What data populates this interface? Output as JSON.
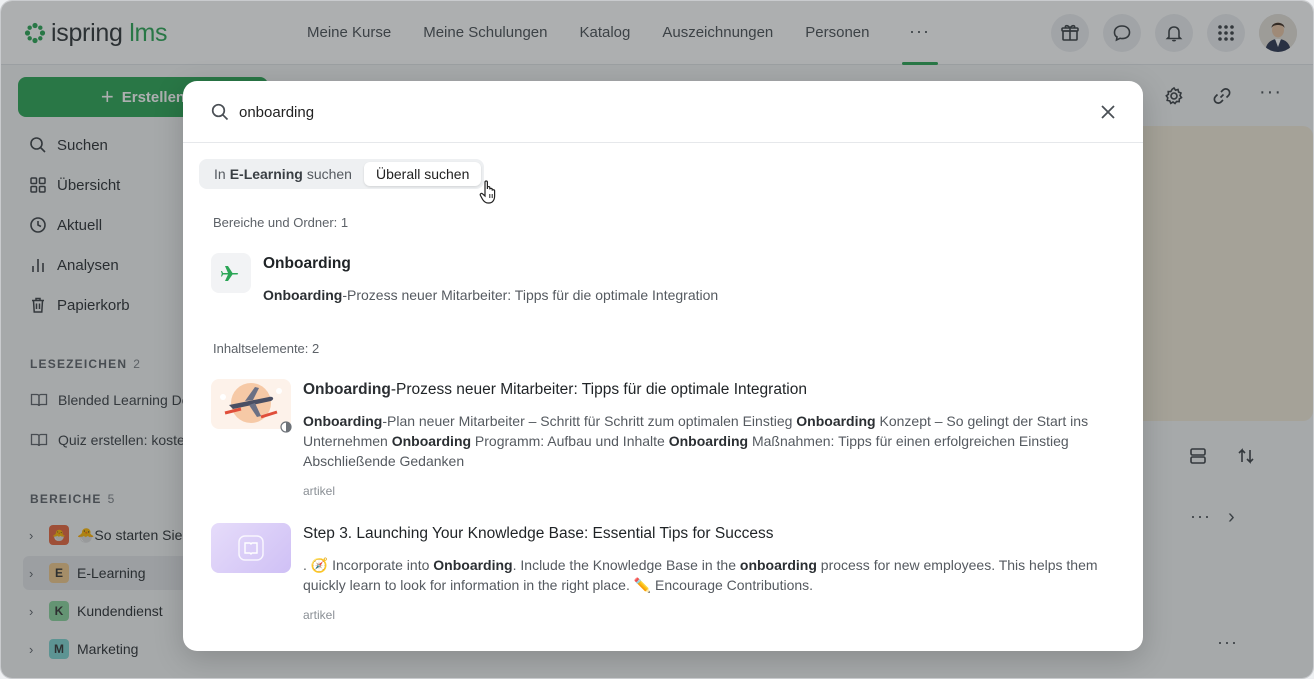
{
  "brand": {
    "name_prefix": "ispring",
    "name_suffix": "lms",
    "accent": "#2aa555"
  },
  "nav": {
    "items": [
      "Meine Kurse",
      "Meine Schulungen",
      "Katalog",
      "Auszeichnungen",
      "Personen"
    ],
    "more_label": "···"
  },
  "top_icons": [
    "gift-icon",
    "chat-icon",
    "bell-icon",
    "apps-grid-icon",
    "user-avatar"
  ],
  "sidebar": {
    "create_label": "Erstellen",
    "items": [
      {
        "label": "Suchen",
        "icon": "search-icon"
      },
      {
        "label": "Übersicht",
        "icon": "grid-icon"
      },
      {
        "label": "Aktuell",
        "icon": "clock-icon"
      },
      {
        "label": "Analysen",
        "icon": "bar-chart-icon"
      },
      {
        "label": "Papierkorb",
        "icon": "trash-icon"
      }
    ],
    "bookmarks": {
      "title": "LESEZEICHEN",
      "count": "2",
      "items": [
        "Blended Learning De",
        "Quiz erstellen: koste"
      ]
    },
    "areas": {
      "title": "BEREICHE",
      "count": "5",
      "items": [
        {
          "badge": "🐣",
          "label": "🐣So starten Sie",
          "color": "#e7643c"
        },
        {
          "badge": "E",
          "label": "E-Learning",
          "color": "#f0c98c"
        },
        {
          "badge": "K",
          "label": "Kundendienst",
          "color": "#8ad39d"
        },
        {
          "badge": "M",
          "label": "Marketing",
          "color": "#7fd3d0"
        }
      ]
    }
  },
  "search": {
    "query": "onboarding",
    "scope": {
      "option1_prefix": "In",
      "option1_bold": "E-Learning",
      "option1_suffix": "suchen",
      "option2": "Überall suchen",
      "selected": "option2"
    },
    "sections": {
      "folders_label": "Bereiche und Ordner: 1",
      "content_label": "Inhaltselemente: 2"
    },
    "folder_result": {
      "title": "Onboarding",
      "desc_bold": "Onboarding",
      "desc_rest": "-Prozess neuer Mitarbeiter: Tipps für die optimale Integration"
    },
    "content_results": [
      {
        "title_bold": "Onboarding",
        "title_rest": "-Prozess neuer Mitarbeiter: Tipps für die optimale Integration",
        "desc": [
          {
            "b": "Onboarding"
          },
          {
            "t": "-Plan neuer Mitarbeiter – Schritt für Schritt zum optimalen Einstieg "
          },
          {
            "b": "Onboarding"
          },
          {
            "t": " Konzept – So gelingt der Start ins Unternehmen "
          },
          {
            "b": "Onboarding"
          },
          {
            "t": " Programm: Aufbau und Inhalte "
          },
          {
            "b": "Onboarding"
          },
          {
            "t": " Maßnahmen: Tipps für einen erfolgreichen Einstieg Abschließende Gedanken"
          }
        ],
        "type": "artikel"
      },
      {
        "title": "Step 3. Launching Your Knowledge Base: Essential Tips for Success",
        "desc": [
          {
            "t": ". 🧭 Incorporate into "
          },
          {
            "b": "Onboarding"
          },
          {
            "t": ". Include the Knowledge Base in the "
          },
          {
            "b": "onboarding"
          },
          {
            "t": " process for new employees. This helps them quickly learn to look for information in the right place. ✏️ Encourage Contributions."
          }
        ],
        "type": "artikel"
      }
    ]
  }
}
